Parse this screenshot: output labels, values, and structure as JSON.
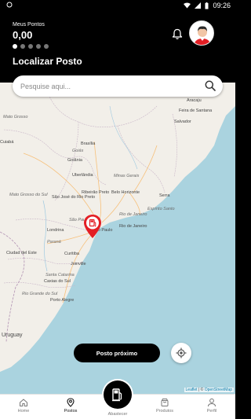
{
  "status_bar": {
    "time": "09:26"
  },
  "header": {
    "points_label": "Meus Pontos",
    "points_value": "0,00",
    "page_title": "Localizar Posto",
    "carousel_total": 5,
    "carousel_active": 1
  },
  "search": {
    "placeholder": "Pesquise aqui..."
  },
  "map": {
    "labels": {
      "aracaju": "Aracaju",
      "feira": "Feira de Santana",
      "salvador": "Salvador",
      "mato_grosso": "Mato Grosso",
      "cuiaba": "Cuiabá",
      "brasilia": "Brasília",
      "goias": "Goiás",
      "goiania": "Goiânia",
      "uberlandia": "Uberlândia",
      "minas": "Minas Gerais",
      "mato_grosso_sul": "Mato Grosso do Sul",
      "sjrp": "São José do Rio Preto",
      "ribeirao": "Ribeirão Preto",
      "bh": "Belo Horizonte",
      "serra": "Serra",
      "espirito": "Espírito Santo",
      "sao_paulo_state": "São Paulo",
      "sao_paulo": "São Paulo",
      "rio_state": "Rio de Janeiro",
      "rio": "Rio de Janeiro",
      "londrina": "Londrina",
      "parana": "Paraná",
      "curitiba": "Curitiba",
      "cidade_leste": "Ciudad del Este",
      "joinville": "Joinville",
      "santa_catarina": "Santa Catarina",
      "caxias": "Caxias do Sul",
      "porto_alegre": "Porto Alegre",
      "rio_grande": "Rio Grande do Sul",
      "uruguay": "Uruguay"
    },
    "attribution_leaflet": "Leaflet",
    "attribution_sep": " | © ",
    "attribution_osm": "OpenStreetMap"
  },
  "actions": {
    "nearest_button": "Posto próximo"
  },
  "nav": {
    "home": "Home",
    "postos": "Postos",
    "abastecer": "Abastecer",
    "produtos": "Produtos",
    "perfil": "Perfil"
  },
  "colors": {
    "brand_red": "#e31e24",
    "sea": "#aad3df",
    "land": "#f2efe9",
    "header_bg": "#000000"
  },
  "icons": [
    "wifi-icon",
    "signal-icon",
    "battery-icon",
    "bell-icon",
    "avatar",
    "search-icon",
    "fuel-pin-icon",
    "locate-icon",
    "home-icon",
    "location-pin-icon",
    "fuel-pump-icon",
    "shopping-bag-icon",
    "user-icon"
  ]
}
